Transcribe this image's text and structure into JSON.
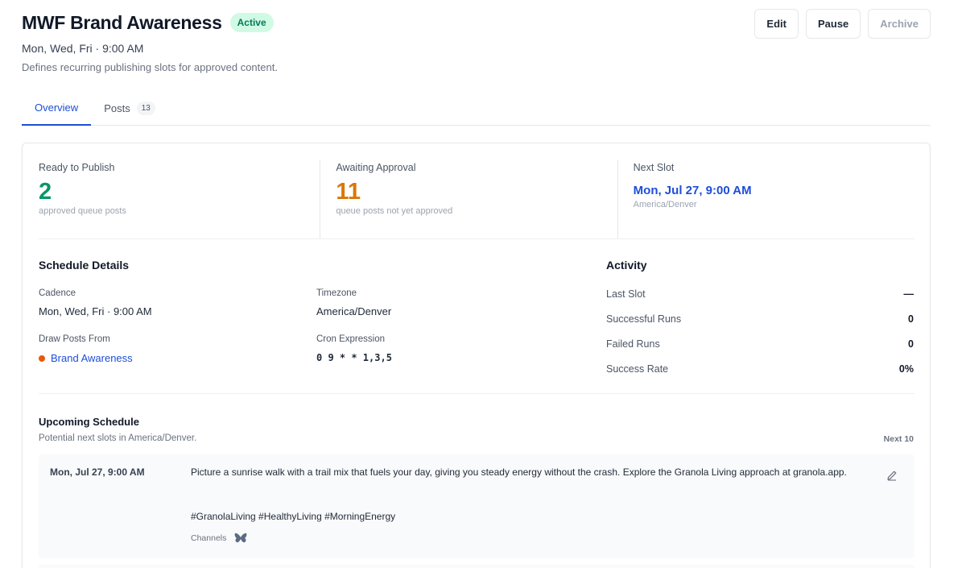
{
  "header": {
    "title": "MWF Brand Awareness",
    "status": "Active",
    "subtitle": "Mon, Wed, Fri · 9:00 AM",
    "description": "Defines recurring publishing slots for approved content.",
    "actions": {
      "edit": "Edit",
      "pause": "Pause",
      "archive": "Archive"
    }
  },
  "tabs": [
    {
      "label": "Overview",
      "active": true
    },
    {
      "label": "Posts",
      "count": "13"
    }
  ],
  "stats": {
    "ready": {
      "label": "Ready to Publish",
      "value": "2",
      "sub": "approved queue posts"
    },
    "awaiting": {
      "label": "Awaiting Approval",
      "value": "11",
      "sub": "queue posts not yet approved"
    },
    "next": {
      "label": "Next Slot",
      "value": "Mon, Jul 27, 9:00 AM",
      "sub": "America/Denver"
    }
  },
  "schedule": {
    "title": "Schedule Details",
    "cadence_label": "Cadence",
    "cadence": "Mon, Wed, Fri · 9:00 AM",
    "timezone_label": "Timezone",
    "timezone": "America/Denver",
    "source_label": "Draw Posts From",
    "source": "Brand Awareness",
    "source_color": "#ea580c",
    "cron_label": "Cron Expression",
    "cron": "0 9 * * 1,3,5"
  },
  "activity": {
    "title": "Activity",
    "rows": [
      {
        "label": "Last Slot",
        "value": "—"
      },
      {
        "label": "Successful Runs",
        "value": "0"
      },
      {
        "label": "Failed Runs",
        "value": "0"
      },
      {
        "label": "Success Rate",
        "value": "0%"
      }
    ]
  },
  "upcoming": {
    "title": "Upcoming Schedule",
    "subtitle": "Potential next slots in America/Denver.",
    "count_label": "Next 10",
    "slots": [
      {
        "date": "Mon, Jul 27, 9:00 AM",
        "text": "Picture a sunrise walk with a trail mix that fuels your day, giving you steady energy without the crash. Explore the Granola Living approach at granola.app.",
        "tags": "#GranolaLiving #HealthyLiving #MorningEnergy",
        "channels_label": "Channels",
        "channel_icon": "butterfly-icon"
      }
    ]
  },
  "colors": {
    "accent": "#1d4ed8",
    "success": "#059669",
    "warning": "#d97706",
    "badge_bg": "#d1fae5"
  }
}
